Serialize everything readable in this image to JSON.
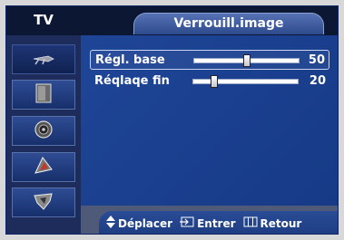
{
  "sidebar": {
    "header_label": "TV",
    "items": [
      {
        "icon": "antenna-icon",
        "label": "Channel"
      },
      {
        "icon": "picture-icon",
        "label": "Picture"
      },
      {
        "icon": "speaker-icon",
        "label": "Sound"
      },
      {
        "icon": "setup-icon",
        "label": "Setup"
      },
      {
        "icon": "input-icon",
        "label": "Input"
      }
    ]
  },
  "header": {
    "title": "Verrouill.image"
  },
  "menu": {
    "rows": [
      {
        "label": "Régl. base",
        "value": "50",
        "level": 0.5,
        "selected": true
      },
      {
        "label": "Réqlaqe fin",
        "value": "20",
        "level": 0.2,
        "selected": false
      }
    ]
  },
  "footer": {
    "move": "Déplacer",
    "enter": "Entrer",
    "back": "Retour"
  },
  "colors": {
    "panel_blue": "#1a3e8c",
    "header_dark": "#0c1733",
    "footer_gray": "#4f5a78"
  }
}
